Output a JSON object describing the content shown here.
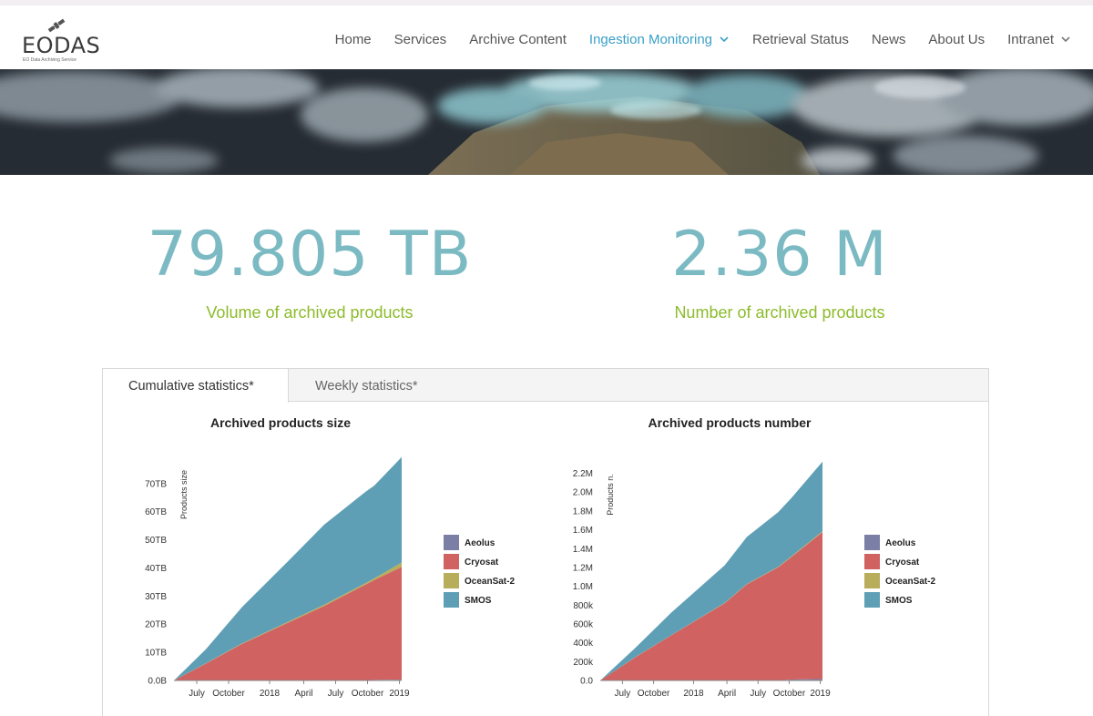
{
  "logo": {
    "name": "EODAS",
    "tagline": "EO Data Archiving Service"
  },
  "nav": {
    "items": [
      {
        "label": "Home",
        "active": false,
        "dropdown": false
      },
      {
        "label": "Services",
        "active": false,
        "dropdown": false
      },
      {
        "label": "Archive Content",
        "active": false,
        "dropdown": false
      },
      {
        "label": "Ingestion Monitoring",
        "active": true,
        "dropdown": true
      },
      {
        "label": "Retrieval Status",
        "active": false,
        "dropdown": false
      },
      {
        "label": "News",
        "active": false,
        "dropdown": false
      },
      {
        "label": "About Us",
        "active": false,
        "dropdown": false
      },
      {
        "label": "Intranet",
        "active": false,
        "dropdown": true
      }
    ]
  },
  "stats": {
    "volume": {
      "value": "79.805 TB",
      "label": "Volume of archived products"
    },
    "number": {
      "value": "2.36 M",
      "label": "Number of archived products"
    }
  },
  "tabs": [
    {
      "label": "Cumulative statistics*",
      "active": true
    },
    {
      "label": "Weekly statistics*",
      "active": false
    }
  ],
  "colors": {
    "accent": "#3a9fc8",
    "stat_value": "#7cbac3",
    "stat_label": "#8dbb2c",
    "Aeolus": "#7b7fa5",
    "Cryosat": "#d06262",
    "OceanSat-2": "#b8ad5a",
    "SMOS": "#5f9fb5"
  },
  "chart_data": [
    {
      "type": "area",
      "stacked": true,
      "title": "Archived products size",
      "ylabel": "Products size",
      "xlabel": "",
      "x_ticks": [
        "July",
        "October",
        "2018",
        "April",
        "July",
        "October",
        "2019"
      ],
      "y_ticks": [
        "0.0B",
        "10TB",
        "20TB",
        "30TB",
        "40TB",
        "50TB",
        "60TB",
        "70TB"
      ],
      "ylim": [
        0,
        79
      ],
      "x": [
        0,
        0.14,
        0.3,
        0.5,
        0.66,
        0.84,
        0.88,
        1.0
      ],
      "series": [
        {
          "name": "Aeolus",
          "values": [
            0,
            0,
            0,
            0,
            0,
            0,
            0.2,
            0.3
          ]
        },
        {
          "name": "Cryosat",
          "values": [
            0,
            6,
            13,
            20.5,
            26.5,
            34,
            35.5,
            40
          ]
        },
        {
          "name": "OceanSat-2",
          "values": [
            0,
            0.1,
            0.2,
            0.3,
            0.4,
            0.5,
            0.6,
            1.6
          ]
        },
        {
          "name": "SMOS",
          "values": [
            0,
            5,
            13,
            21.5,
            28.5,
            32.5,
            33,
            37.5
          ]
        }
      ],
      "legend": "right"
    },
    {
      "type": "area",
      "stacked": true,
      "title": "Archived products number",
      "ylabel": "Products n.",
      "xlabel": "",
      "x_ticks": [
        "July",
        "October",
        "2018",
        "April",
        "July",
        "October",
        "2019"
      ],
      "y_ticks": [
        "0.0",
        "200k",
        "400k",
        "600k",
        "800k",
        "1.0M",
        "1.2M",
        "1.4M",
        "1.6M",
        "1.8M",
        "2.0M",
        "2.2M"
      ],
      "ylim": [
        0,
        2360000
      ],
      "x": [
        0,
        0.16,
        0.32,
        0.56,
        0.66,
        0.8,
        0.86,
        1.0
      ],
      "series": [
        {
          "name": "Aeolus",
          "values": [
            0,
            0,
            0,
            0,
            0,
            0,
            10000,
            15000
          ]
        },
        {
          "name": "Cryosat",
          "values": [
            0,
            250000,
            480000,
            820000,
            1020000,
            1200000,
            1300000,
            1560000
          ]
        },
        {
          "name": "OceanSat-2",
          "values": [
            0,
            1000,
            2000,
            3000,
            4000,
            5000,
            6000,
            8000
          ]
        },
        {
          "name": "SMOS",
          "values": [
            0,
            100000,
            240000,
            400000,
            500000,
            580000,
            620000,
            740000
          ]
        }
      ],
      "legend": "right"
    }
  ]
}
